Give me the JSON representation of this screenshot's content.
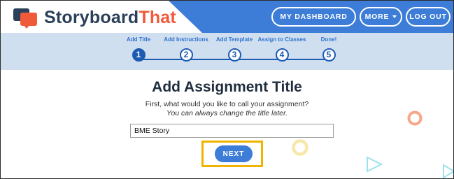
{
  "brand": {
    "name_part1": "Storyboard",
    "name_part2": "That"
  },
  "nav": {
    "dashboard": "MY DASHBOARD",
    "more": "MORE",
    "logout": "LOG OUT"
  },
  "steps": [
    {
      "label": "Add Title",
      "number": "1",
      "active": true
    },
    {
      "label": "Add Instructions",
      "number": "2",
      "active": false
    },
    {
      "label": "Add Template",
      "number": "3",
      "active": false
    },
    {
      "label": "Assign to Classes",
      "number": "4",
      "active": false
    },
    {
      "label": "Done!",
      "number": "5",
      "active": false
    }
  ],
  "main": {
    "title": "Add Assignment Title",
    "prompt": "First, what would you like to call your assignment?",
    "hint": "You can always change the title later.",
    "title_input_value": "BME Story",
    "next_label": "NEXT"
  },
  "colors": {
    "accent_blue": "#3d7dd8",
    "dark_blue": "#1d5bb3",
    "steps_bg": "#cfdff0",
    "brand_orange": "#f05a3a",
    "brand_navy": "#2a3f5a",
    "highlight": "#f0b400"
  }
}
